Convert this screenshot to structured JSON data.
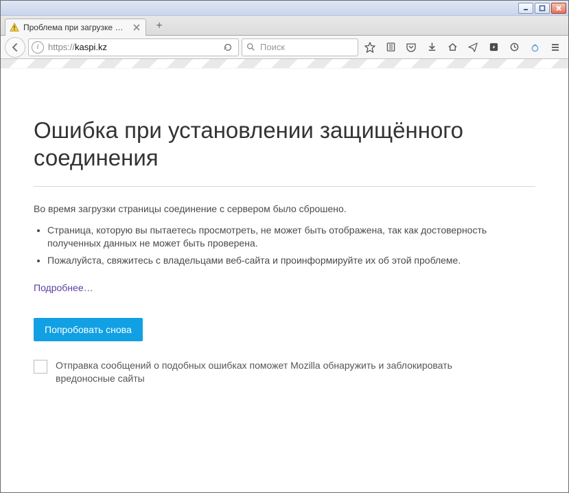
{
  "tab": {
    "title": "Проблема при загрузке стр…"
  },
  "toolbar": {
    "url_scheme": "https://",
    "url_host": "kaspi.kz",
    "search_placeholder": "Поиск"
  },
  "page": {
    "heading": "Ошибка при установлении защищённого соединения",
    "lead": "Во время загрузки страницы соединение с сервером было сброшено.",
    "causes": [
      "Страница, которую вы пытаетесь просмотреть, не может быть отображена, так как достоверность полученных данных не может быть проверена.",
      "Пожалуйста, свяжитесь с владельцами веб-сайта и проинформируйте их об этой проблеме."
    ],
    "more": "Подробнее…",
    "retry": "Попробовать снова",
    "report_label": "Отправка сообщений о подобных ошибках поможет Mozilla обнаружить и заблокировать вредоносные сайты"
  }
}
